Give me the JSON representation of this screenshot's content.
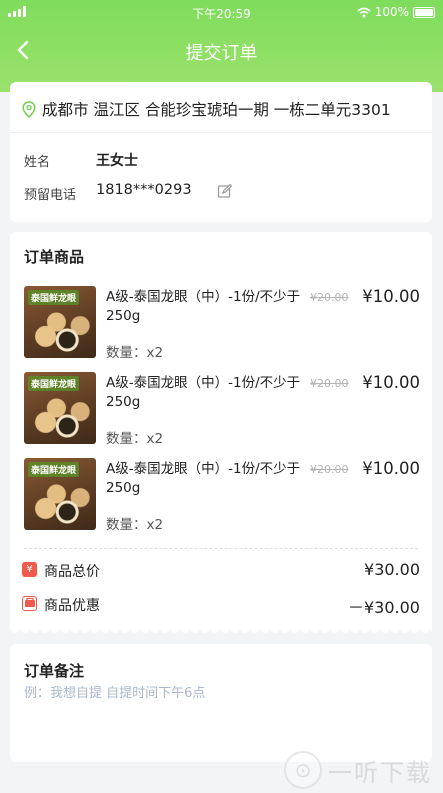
{
  "status_bar": {
    "time": "下午20:59",
    "battery": "100%"
  },
  "nav": {
    "title": "提交订单"
  },
  "address": {
    "text": "成都市 温江区 合能珍宝琥珀一期 一栋二单元3301",
    "name_label": "姓名",
    "name_value": "王女士",
    "phone_label": "预留电话",
    "phone_value": "1818***0293"
  },
  "goods": {
    "title": "订单商品",
    "items": [
      {
        "name": "A级-泰国龙眼（中）-1份/不少于250g",
        "old_price": "¥20.00",
        "price": "¥10.00",
        "qty": "数量：x2",
        "image_label": "泰国鲜龙眼"
      },
      {
        "name": "A级-泰国龙眼（中）-1份/不少于250g",
        "old_price": "¥20.00",
        "price": "¥10.00",
        "qty": "数量：x2",
        "image_label": "泰国鲜龙眼"
      },
      {
        "name": "A级-泰国龙眼（中）-1份/不少于250g",
        "old_price": "¥20.00",
        "price": "¥10.00",
        "qty": "数量：x2",
        "image_label": "泰国鲜龙眼"
      }
    ]
  },
  "summary": {
    "total_label": "商品总价",
    "total_value": "¥30.00",
    "discount_label": "商品优惠",
    "discount_value": "－¥30.00"
  },
  "remark": {
    "title": "订单备注",
    "placeholder": "例：我想自提 自提时间下午6点"
  },
  "watermark": {
    "text": "一听下载"
  },
  "colors": {
    "header_green": "#7fdc5c",
    "summary_icon_red": "#f05a4a"
  }
}
